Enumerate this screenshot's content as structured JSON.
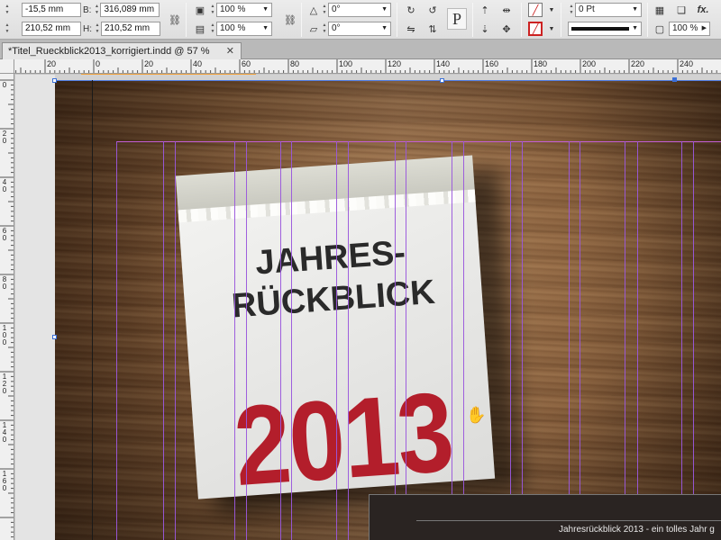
{
  "control_panel": {
    "x": {
      "value": "-15,5 mm"
    },
    "y": {
      "value": "210,52 mm"
    },
    "w": {
      "label": "B:",
      "value": "316,089 mm"
    },
    "h": {
      "label": "H:",
      "value": "210,52 mm"
    },
    "scale_x": "100 %",
    "scale_y": "100 %",
    "rotate": "0°",
    "shear": "0°",
    "stroke_weight": "0 Pt",
    "opacity": "100 %",
    "fx_label": "fx."
  },
  "document": {
    "tab_title": "*Titel_Rueckblick2013_korrigiert.indd @ 57 %",
    "close_glyph": "✕"
  },
  "ruler_h": {
    "labels": [
      "20",
      "0",
      "20",
      "40",
      "60",
      "80",
      "100",
      "120",
      "140",
      "160",
      "180",
      "200",
      "220",
      "240"
    ]
  },
  "ruler_v": {
    "labels": [
      "0",
      "2\n0",
      "4\n0",
      "6\n0",
      "8\n0",
      "1\n0\n0",
      "1\n2\n0",
      "1\n4\n0",
      "1\n6\n0"
    ]
  },
  "artwork": {
    "heading_line1": "JAHRES-",
    "heading_line2": "RÜCKBLICK",
    "year": "2013",
    "caption": "Jahresrückblick 2013 - ein tolles Jahr g"
  },
  "colors": {
    "accent_red": "#b31e2b",
    "guide_purple": "#9a57dc",
    "selection_blue": "#3b6fd6"
  }
}
